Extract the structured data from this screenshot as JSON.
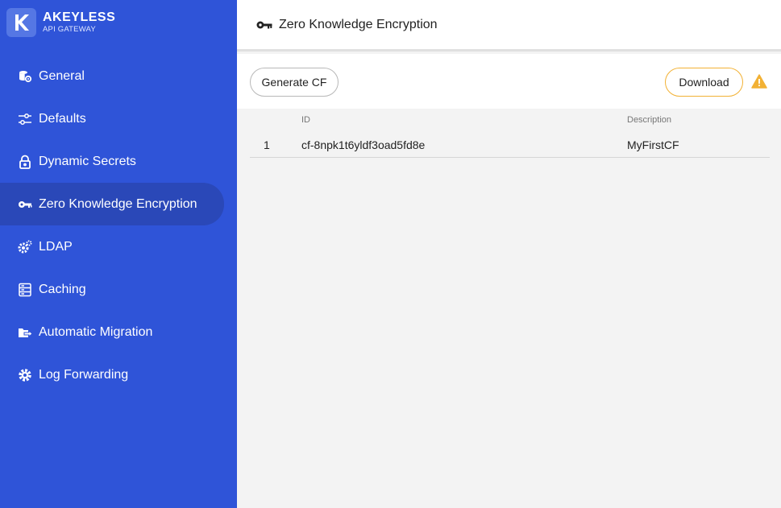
{
  "brand": {
    "name": "AKEYLESS",
    "subtitle": "API GATEWAY"
  },
  "sidebar": {
    "items": [
      {
        "label": "General",
        "icon": "database-gear-icon"
      },
      {
        "label": "Defaults",
        "icon": "sliders-icon"
      },
      {
        "label": "Dynamic Secrets",
        "icon": "lock-icon"
      },
      {
        "label": "Zero Knowledge Encryption",
        "icon": "key-icon",
        "active": true
      },
      {
        "label": "LDAP",
        "icon": "cogs-icon"
      },
      {
        "label": "Caching",
        "icon": "server-icon"
      },
      {
        "label": "Automatic Migration",
        "icon": "migration-icon"
      },
      {
        "label": "Log Forwarding",
        "icon": "gear-icon"
      }
    ]
  },
  "header": {
    "title": "Zero Knowledge Encryption",
    "icon": "key-icon"
  },
  "toolbar": {
    "generate_label": "Generate CF",
    "download_label": "Download",
    "warning_icon": "warning-icon"
  },
  "table": {
    "columns": [
      "ID",
      "Description"
    ],
    "rows": [
      {
        "index": "1",
        "id": "cf-8npk1t6yldf3oad5fd8e",
        "description": "MyFirstCF"
      }
    ]
  },
  "colors": {
    "sidebar_bg": "#2f54d8",
    "active_item_bg": "#2a48b8",
    "download_border": "#f2b134",
    "warning": "#f2b134"
  }
}
